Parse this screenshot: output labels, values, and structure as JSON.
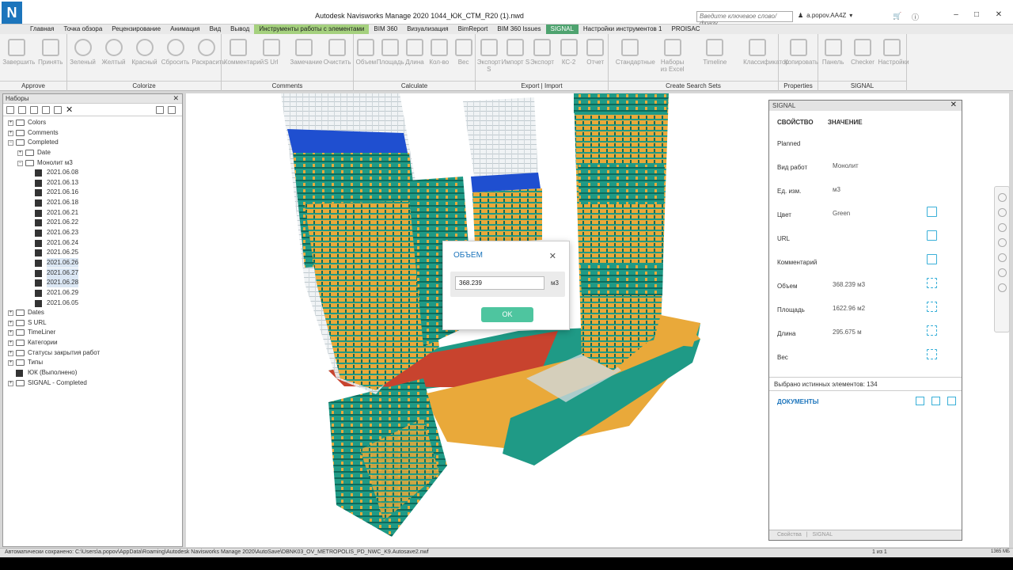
{
  "window": {
    "title": "Autodesk Navisworks Manage 2020    1044_ЮК_СТМ_R20 (1).nwd",
    "logo": "N",
    "search_placeholder": "Введите ключевое слово/фразу",
    "user": "a.popov.AA4Z"
  },
  "menu": {
    "tabs": [
      "Главная",
      "Точка обзора",
      "Рецензирование",
      "Анимация",
      "Вид",
      "Вывод",
      "Инструменты работы с элементами",
      "BIM 360",
      "Визуализация",
      "BimReport",
      "BIM 360 Issues",
      "SIGNAL",
      "Настройки инструментов 1",
      "PROISAC"
    ],
    "active_index": 11,
    "highlight_index": 6
  },
  "ribbon": {
    "panels": [
      {
        "title": "Approve",
        "buttons": [
          "Завершить",
          "Принять"
        ]
      },
      {
        "title": "Colorize",
        "buttons": [
          "Зеленый",
          "Желтый",
          "Красный",
          "Сбросить",
          "Раскрасить"
        ]
      },
      {
        "title": "Comments",
        "buttons": [
          "Комментарий",
          "S Url",
          "Замечание",
          "Очистить"
        ]
      },
      {
        "title": "Calculate",
        "buttons": [
          "Объем",
          "Площадь",
          "Длина",
          "Кол-во",
          "Вес"
        ]
      },
      {
        "title": "Export | Import",
        "buttons": [
          "Экспорт S",
          "Импорт S",
          "Экспорт",
          "КС-2",
          "Отчет"
        ]
      },
      {
        "title": "Create Search Sets",
        "buttons": [
          "Стандартные",
          "Наборы из Excel",
          "Timeline",
          "Классификатор"
        ]
      },
      {
        "title": "Properties",
        "buttons": [
          "Копировать"
        ]
      },
      {
        "title": "SIGNAL",
        "buttons": [
          "Панель",
          "Checker",
          "Настройки"
        ]
      }
    ]
  },
  "sets_panel": {
    "title": "Наборы",
    "tree": [
      {
        "label": "Colors",
        "level": 0,
        "kind": "folder",
        "expanded": false
      },
      {
        "label": "Comments",
        "level": 0,
        "kind": "folder",
        "expanded": false
      },
      {
        "label": "Completed",
        "level": 0,
        "kind": "folder",
        "expanded": true
      },
      {
        "label": "Date",
        "level": 1,
        "kind": "folder",
        "expanded": false
      },
      {
        "label": "Монолит м3",
        "level": 1,
        "kind": "folder",
        "expanded": true
      },
      {
        "label": "2021.06.08",
        "level": 2,
        "kind": "set"
      },
      {
        "label": "2021.06.13",
        "level": 2,
        "kind": "set"
      },
      {
        "label": "2021.06.16",
        "level": 2,
        "kind": "set"
      },
      {
        "label": "2021.06.18",
        "level": 2,
        "kind": "set"
      },
      {
        "label": "2021.06.21",
        "level": 2,
        "kind": "set"
      },
      {
        "label": "2021.06.22",
        "level": 2,
        "kind": "set"
      },
      {
        "label": "2021.06.23",
        "level": 2,
        "kind": "set"
      },
      {
        "label": "2021.06.24",
        "level": 2,
        "kind": "set"
      },
      {
        "label": "2021.06.25",
        "level": 2,
        "kind": "set"
      },
      {
        "label": "2021.06.26",
        "level": 2,
        "kind": "set",
        "selected": true
      },
      {
        "label": "2021.06.27",
        "level": 2,
        "kind": "set",
        "selected": true
      },
      {
        "label": "2021.06.28",
        "level": 2,
        "kind": "set",
        "selected": true
      },
      {
        "label": "2021.06.29",
        "level": 2,
        "kind": "set"
      },
      {
        "label": "2021.06.05",
        "level": 2,
        "kind": "set"
      },
      {
        "label": "Dates",
        "level": 0,
        "kind": "folder",
        "expanded": false
      },
      {
        "label": "S URL",
        "level": 0,
        "kind": "folder",
        "expanded": false
      },
      {
        "label": "TimeLiner",
        "level": 0,
        "kind": "folder",
        "expanded": false
      },
      {
        "label": "Категории",
        "level": 0,
        "kind": "folder",
        "expanded": false
      },
      {
        "label": "Статусы закрытия работ",
        "level": 0,
        "kind": "folder",
        "expanded": false
      },
      {
        "label": "Типы",
        "level": 0,
        "kind": "folder",
        "expanded": false
      },
      {
        "label": "ЮК (Выполнено)",
        "level": 0,
        "kind": "set"
      },
      {
        "label": "SIGNAL - Completed",
        "level": 0,
        "kind": "folder",
        "expanded": false
      }
    ]
  },
  "dialog": {
    "title": "ОБЪЕМ",
    "value": "368.239",
    "unit": "м3",
    "ok_label": "OK"
  },
  "signal_panel": {
    "title": "SIGNAL",
    "col_property": "СВОЙСТВО",
    "col_value": "ЗНАЧЕНИЕ",
    "rows": [
      {
        "key": "Planned",
        "value": "",
        "button": "none"
      },
      {
        "key": "Вид работ",
        "value": "Монолит",
        "button": "none"
      },
      {
        "key": "Ед. изм.",
        "value": "м3",
        "button": "none"
      },
      {
        "key": "Цвет",
        "value": "Green",
        "button": "edit"
      },
      {
        "key": "URL",
        "value": "",
        "button": "edit"
      },
      {
        "key": "Комментарий",
        "value": "",
        "button": "edit"
      },
      {
        "key": "Объем",
        "value": "368.239 м3",
        "button": "calc"
      },
      {
        "key": "Площадь",
        "value": "1622.96 м2",
        "button": "calc"
      },
      {
        "key": "Длина",
        "value": "295.675 м",
        "button": "calc"
      },
      {
        "key": "Вес",
        "value": "",
        "button": "calc"
      }
    ],
    "selected_text": "Выбрано истинных элементов: 134",
    "docs_title": "ДОКУМЕНТЫ",
    "bottom_tabs": [
      "Свойства",
      "SIGNAL"
    ]
  },
  "status": {
    "autosave": "Автоматически сохранено: C:\\Users\\a.popov\\AppData\\Roaming\\Autodesk Navisworks Manage 2020\\AutoSave\\DBNK03_OV_METROPOLIS_PD_NWC_K9.Autosave2.nwf",
    "pager": "1 из 1",
    "memory": "1365 МБ"
  },
  "colors": {
    "teal": "#1f9a86",
    "orange": "#e9a93a",
    "red": "#c8432e",
    "blue": "#1f4fd0",
    "accent": "#1c75bc",
    "ok_button": "#4ec59f"
  }
}
